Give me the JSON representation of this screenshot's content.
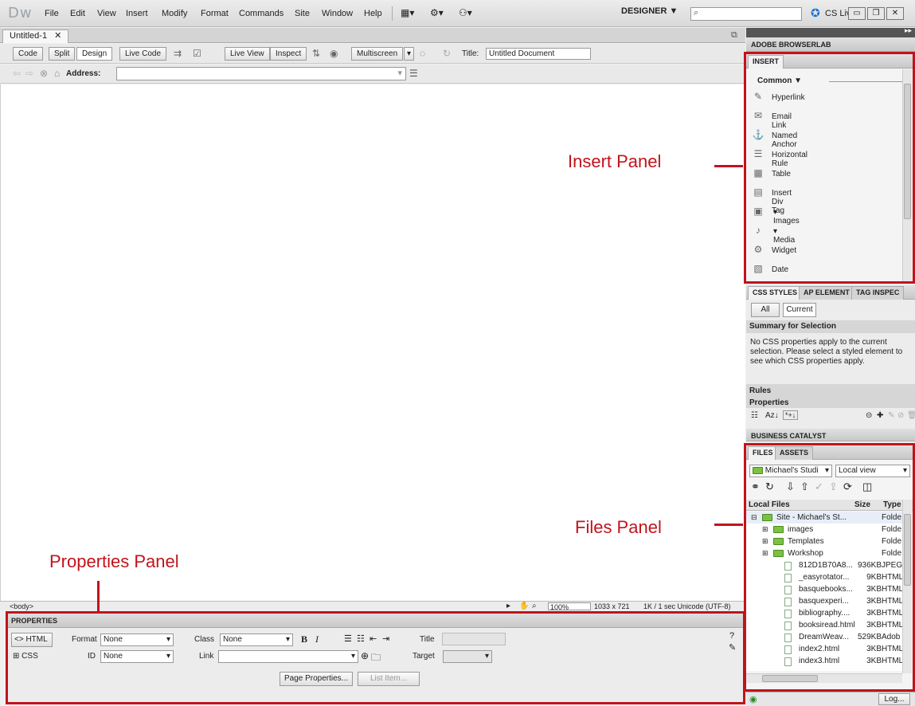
{
  "app": {
    "logo": "Dw",
    "menu": [
      "File",
      "Edit",
      "View",
      "Insert",
      "Modify",
      "Format",
      "Commands",
      "Site",
      "Window",
      "Help"
    ],
    "workspace": "DESIGNER ▼",
    "cslive": "CS Live"
  },
  "document": {
    "tab": "Untitled-1",
    "view_buttons": [
      "Code",
      "Split",
      "Design"
    ],
    "live_code": "Live Code",
    "live_view": "Live View",
    "inspect": "Inspect",
    "multiscreen": "Multiscreen",
    "title_label": "Title:",
    "title_value": "Untitled Document",
    "address_label": "Address:"
  },
  "statusbar": {
    "tag": "<body>",
    "zoom": "100%",
    "size": "1033 x 721",
    "info": "1K / 1 sec  Unicode (UTF-8)"
  },
  "properties": {
    "header": "PROPERTIES",
    "html_btn": "<> HTML",
    "css_btn": "CSS",
    "format_label": "Format",
    "format_value": "None",
    "id_label": "ID",
    "id_value": "None",
    "class_label": "Class",
    "class_value": "None",
    "link_label": "Link",
    "title_label": "Title",
    "target_label": "Target",
    "page_properties": "Page Properties...",
    "list_item": "List Item..."
  },
  "panels": {
    "browserlab": "ADOBE BROWSERLAB",
    "insert_tab": "INSERT",
    "insert_category": "Common",
    "insert_items": [
      {
        "label": "Hyperlink",
        "icon": "hyperlink-icon"
      },
      {
        "label": "Email Link",
        "icon": "email-icon"
      },
      {
        "label": "Named Anchor",
        "icon": "anchor-icon"
      },
      {
        "label": "Horizontal Rule",
        "icon": "rule-icon"
      },
      {
        "label": "Table",
        "icon": "table-icon"
      },
      {
        "label": "Insert Div Tag",
        "icon": "div-icon"
      },
      {
        "label": "Images",
        "icon": "image-icon"
      },
      {
        "label": "Media",
        "icon": "media-icon"
      },
      {
        "label": "Widget",
        "icon": "widget-icon"
      },
      {
        "label": "Date",
        "icon": "calendar-icon"
      }
    ],
    "css_tabs": [
      "CSS STYLES",
      "AP ELEMENT",
      "TAG INSPEC"
    ],
    "css_mode": [
      "All",
      "Current"
    ],
    "summary_title": "Summary for Selection",
    "summary_text": "No CSS properties apply to the current selection.  Please select a styled element to see which CSS properties apply.",
    "rules": "Rules",
    "properties": "Properties",
    "business_catalyst": "BUSINESS CATALYST",
    "files_tabs": [
      "FILES",
      "ASSETS"
    ],
    "site_select": "Michael's Studi",
    "view_select": "Local view",
    "files_header": {
      "name": "Local Files",
      "size": "Size",
      "type": "Type"
    },
    "files": [
      {
        "name": "Site - Michael's St...",
        "size": "",
        "type": "Folde",
        "kind": "site",
        "indent": 0
      },
      {
        "name": "images",
        "size": "",
        "type": "Folde",
        "kind": "folder",
        "indent": 1
      },
      {
        "name": "Templates",
        "size": "",
        "type": "Folde",
        "kind": "folder",
        "indent": 1
      },
      {
        "name": "Workshop",
        "size": "",
        "type": "Folde",
        "kind": "folder",
        "indent": 1
      },
      {
        "name": "812D1B70A8...",
        "size": "936KB",
        "type": "JPEG",
        "kind": "file",
        "indent": 2
      },
      {
        "name": "_easyrotator...",
        "size": "9KB",
        "type": "HTML",
        "kind": "file",
        "indent": 2
      },
      {
        "name": "basquebooks...",
        "size": "3KB",
        "type": "HTML",
        "kind": "file",
        "indent": 2
      },
      {
        "name": "basquexperi...",
        "size": "3KB",
        "type": "HTML",
        "kind": "file",
        "indent": 2
      },
      {
        "name": "bibliography....",
        "size": "3KB",
        "type": "HTML",
        "kind": "file",
        "indent": 2
      },
      {
        "name": "booksiread.html",
        "size": "3KB",
        "type": "HTML",
        "kind": "file",
        "indent": 2
      },
      {
        "name": "DreamWeav...",
        "size": "529KB",
        "type": "Adob",
        "kind": "file",
        "indent": 2
      },
      {
        "name": "index2.html",
        "size": "3KB",
        "type": "HTML",
        "kind": "file",
        "indent": 2
      },
      {
        "name": "index3.html",
        "size": "3KB",
        "type": "HTML",
        "kind": "file",
        "indent": 2
      }
    ],
    "log_btn": "Log..."
  },
  "annotations": {
    "insert": "Insert Panel",
    "files": "Files Panel",
    "properties": "Properties Panel"
  },
  "colors": {
    "annotation": "#c0141c"
  }
}
